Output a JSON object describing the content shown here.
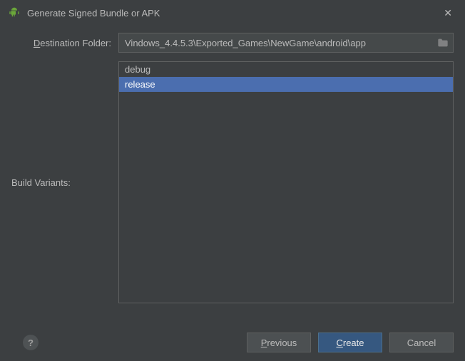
{
  "title": "Generate Signed Bundle or APK",
  "labels": {
    "destination_pre": "D",
    "destination_post": "estination Folder:",
    "build_variants_pre": "B",
    "build_variants_post": "uild Variants:"
  },
  "destination": {
    "value": "Vindows_4.4.5.3\\Exported_Games\\NewGame\\android\\app"
  },
  "variants": {
    "items": [
      "debug",
      "release"
    ],
    "selected_index": 1
  },
  "buttons": {
    "previous_pre": "P",
    "previous_post": "revious",
    "create_pre": "C",
    "create_post": "reate",
    "cancel": "Cancel",
    "help": "?"
  }
}
